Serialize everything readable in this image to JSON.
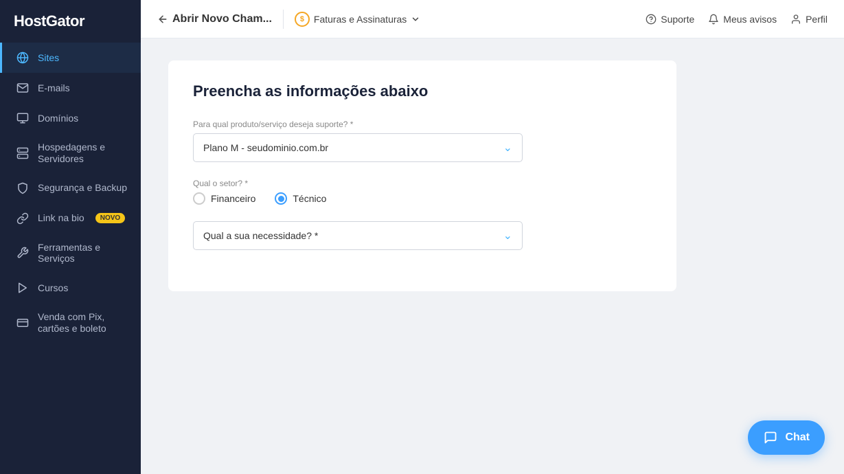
{
  "sidebar": {
    "logo": "HostGator",
    "items": [
      {
        "id": "sites",
        "label": "Sites",
        "active": true
      },
      {
        "id": "emails",
        "label": "E-mails",
        "active": false
      },
      {
        "id": "dominios",
        "label": "Domínios",
        "active": false
      },
      {
        "id": "hospedagens",
        "label": "Hospedagens e Servidores",
        "active": false
      },
      {
        "id": "seguranca",
        "label": "Segurança e Backup",
        "active": false
      },
      {
        "id": "linknabio",
        "label": "Link na bio",
        "active": false,
        "badge": "NOVO"
      },
      {
        "id": "ferramentas",
        "label": "Ferramentas e Serviços",
        "active": false
      },
      {
        "id": "cursos",
        "label": "Cursos",
        "active": false
      },
      {
        "id": "venda",
        "label": "Venda com Pix, cartões e boleto",
        "active": false
      }
    ]
  },
  "topbar": {
    "back_label": "Abrir Novo Cham...",
    "nav_label": "Faturas e Assinaturas",
    "support_label": "Suporte",
    "notices_label": "Meus avisos",
    "profile_label": "Perfil"
  },
  "form": {
    "title": "Preencha as informações abaixo",
    "product_label": "Para qual produto/serviço deseja suporte? *",
    "product_value": "Plano M - seudominio.com.br",
    "sector_label": "Qual o setor? *",
    "sector_options": [
      {
        "id": "financeiro",
        "label": "Financeiro",
        "checked": false
      },
      {
        "id": "tecnico",
        "label": "Técnico",
        "checked": true
      }
    ],
    "need_placeholder": "Qual a sua necessidade? *"
  },
  "chat": {
    "label": "Chat"
  }
}
